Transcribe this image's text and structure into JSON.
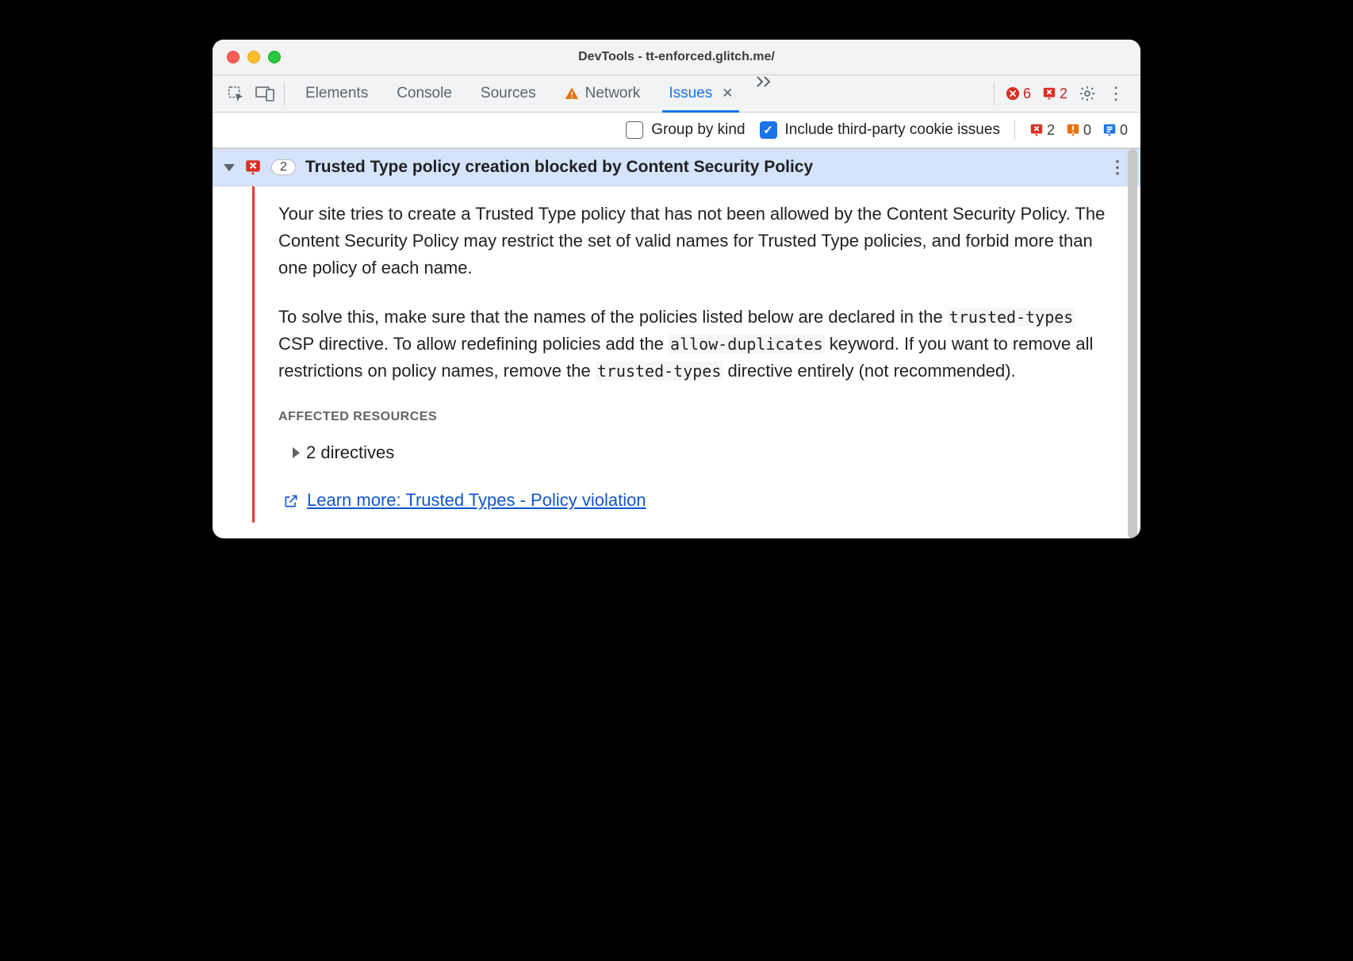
{
  "titlebar": {
    "title": "DevTools - tt-enforced.glitch.me/"
  },
  "tabs": {
    "items": [
      {
        "label": "Elements",
        "active": false,
        "icon": null
      },
      {
        "label": "Console",
        "active": false,
        "icon": null
      },
      {
        "label": "Sources",
        "active": false,
        "icon": null
      },
      {
        "label": "Network",
        "active": false,
        "icon": "warn"
      },
      {
        "label": "Issues",
        "active": true,
        "icon": null,
        "closable": true
      }
    ],
    "error_count": "6",
    "issues_count": "2"
  },
  "filters": {
    "group_by_kind": {
      "label": "Group by kind",
      "checked": false
    },
    "include_third_party": {
      "label": "Include third-party cookie issues",
      "checked": true
    },
    "counts": {
      "errors": "2",
      "warnings": "0",
      "info": "0"
    }
  },
  "issue": {
    "count": "2",
    "title": "Trusted Type policy creation blocked by Content Security Policy",
    "para1": "Your site tries to create a Trusted Type policy that has not been allowed by the Content Security Policy. The Content Security Policy may restrict the set of valid names for Trusted Type policies, and forbid more than one policy of each name.",
    "p2_a": "To solve this, make sure that the names of the policies listed below are declared in the ",
    "p2_code1": "trusted-types",
    "p2_b": " CSP directive. To allow redefining policies add the ",
    "p2_code2": "allow-duplicates",
    "p2_c": " keyword. If you want to remove all restrictions on policy names, remove the ",
    "p2_code3": "trusted-types",
    "p2_d": " directive entirely (not recommended).",
    "affected_label": "AFFECTED RESOURCES",
    "directives_label": "2 directives",
    "learn_more": "Learn more: Trusted Types - Policy violation"
  }
}
